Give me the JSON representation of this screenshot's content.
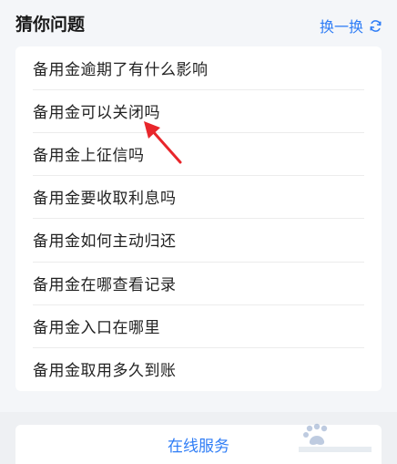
{
  "section": {
    "title": "猜你问题",
    "refresh_label": "换一换"
  },
  "questions": [
    {
      "label": "备用金逾期了有什么影响"
    },
    {
      "label": "备用金可以关闭吗"
    },
    {
      "label": "备用金上征信吗"
    },
    {
      "label": "备用金要收取利息吗"
    },
    {
      "label": "备用金如何主动归还"
    },
    {
      "label": "备用金在哪查看记录"
    },
    {
      "label": "备用金入口在哪里"
    },
    {
      "label": "备用金取用多久到账"
    }
  ],
  "footer": {
    "online_service_label": "在线服务"
  },
  "colors": {
    "accent": "#2f7df6",
    "annotation_arrow": "#e8262b"
  },
  "icons": {
    "refresh": "refresh-icon",
    "arrow": "red-arrow-icon"
  }
}
